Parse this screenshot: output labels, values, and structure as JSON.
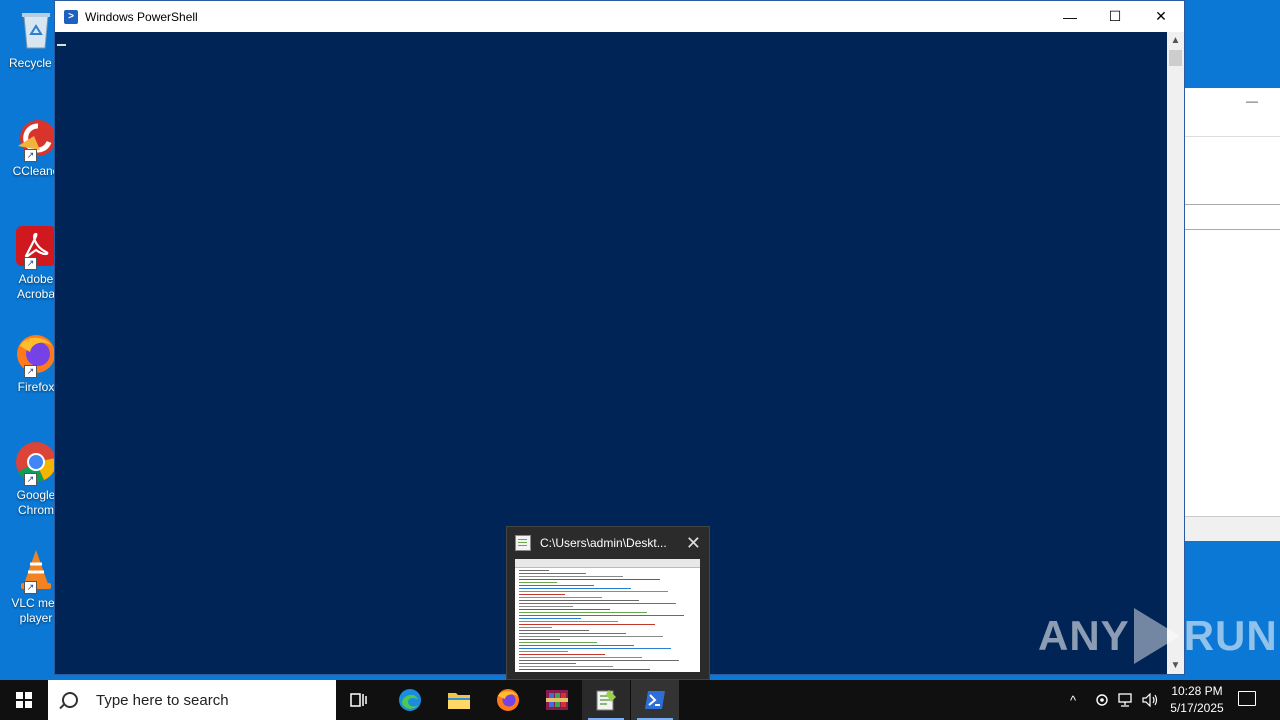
{
  "desktop_icons": [
    {
      "label": "Recycle Bin",
      "visible_label": "Recycle B",
      "icon": "recycle-bin-icon"
    },
    {
      "label": "CCleaner",
      "visible_label": "CCleane",
      "icon": "ccleaner-icon"
    },
    {
      "label": "Adobe Acrobat",
      "visible_label_l1": "Adobe",
      "visible_label_l2": "Acroba",
      "icon": "adobe-acrobat-icon"
    },
    {
      "label": "Firefox",
      "visible_label": "Firefox",
      "icon": "firefox-icon"
    },
    {
      "label": "Google Chrome",
      "visible_label_l1": "Google",
      "visible_label_l2": "Chrom",
      "icon": "chrome-icon"
    },
    {
      "label": "VLC media player",
      "visible_label_l1": "VLC mec",
      "visible_label_l2": "player",
      "icon": "vlc-icon"
    }
  ],
  "powershell": {
    "title": "Windows PowerShell",
    "minimize_glyph": "—",
    "maximize_glyph": "☐",
    "close_glyph": "✕",
    "background": "#012456"
  },
  "preview": {
    "title": "C:\\Users\\admin\\Deskt...",
    "close_glyph": "✕"
  },
  "watermark": {
    "left": "ANY",
    "right": "RUN"
  },
  "taskbar": {
    "search_placeholder": "Type here to search",
    "apps": [
      "task-view-icon",
      "edge-icon",
      "file-explorer-icon",
      "firefox-icon",
      "winrar-icon",
      "notepad-plus-plus-icon",
      "powershell-icon"
    ],
    "tray_up": "^",
    "time": "10:28 PM",
    "date": "5/17/2025"
  },
  "colors": {
    "desktop": "#0a78d4",
    "taskbar": "#101010",
    "accent": "#7aaef5"
  }
}
